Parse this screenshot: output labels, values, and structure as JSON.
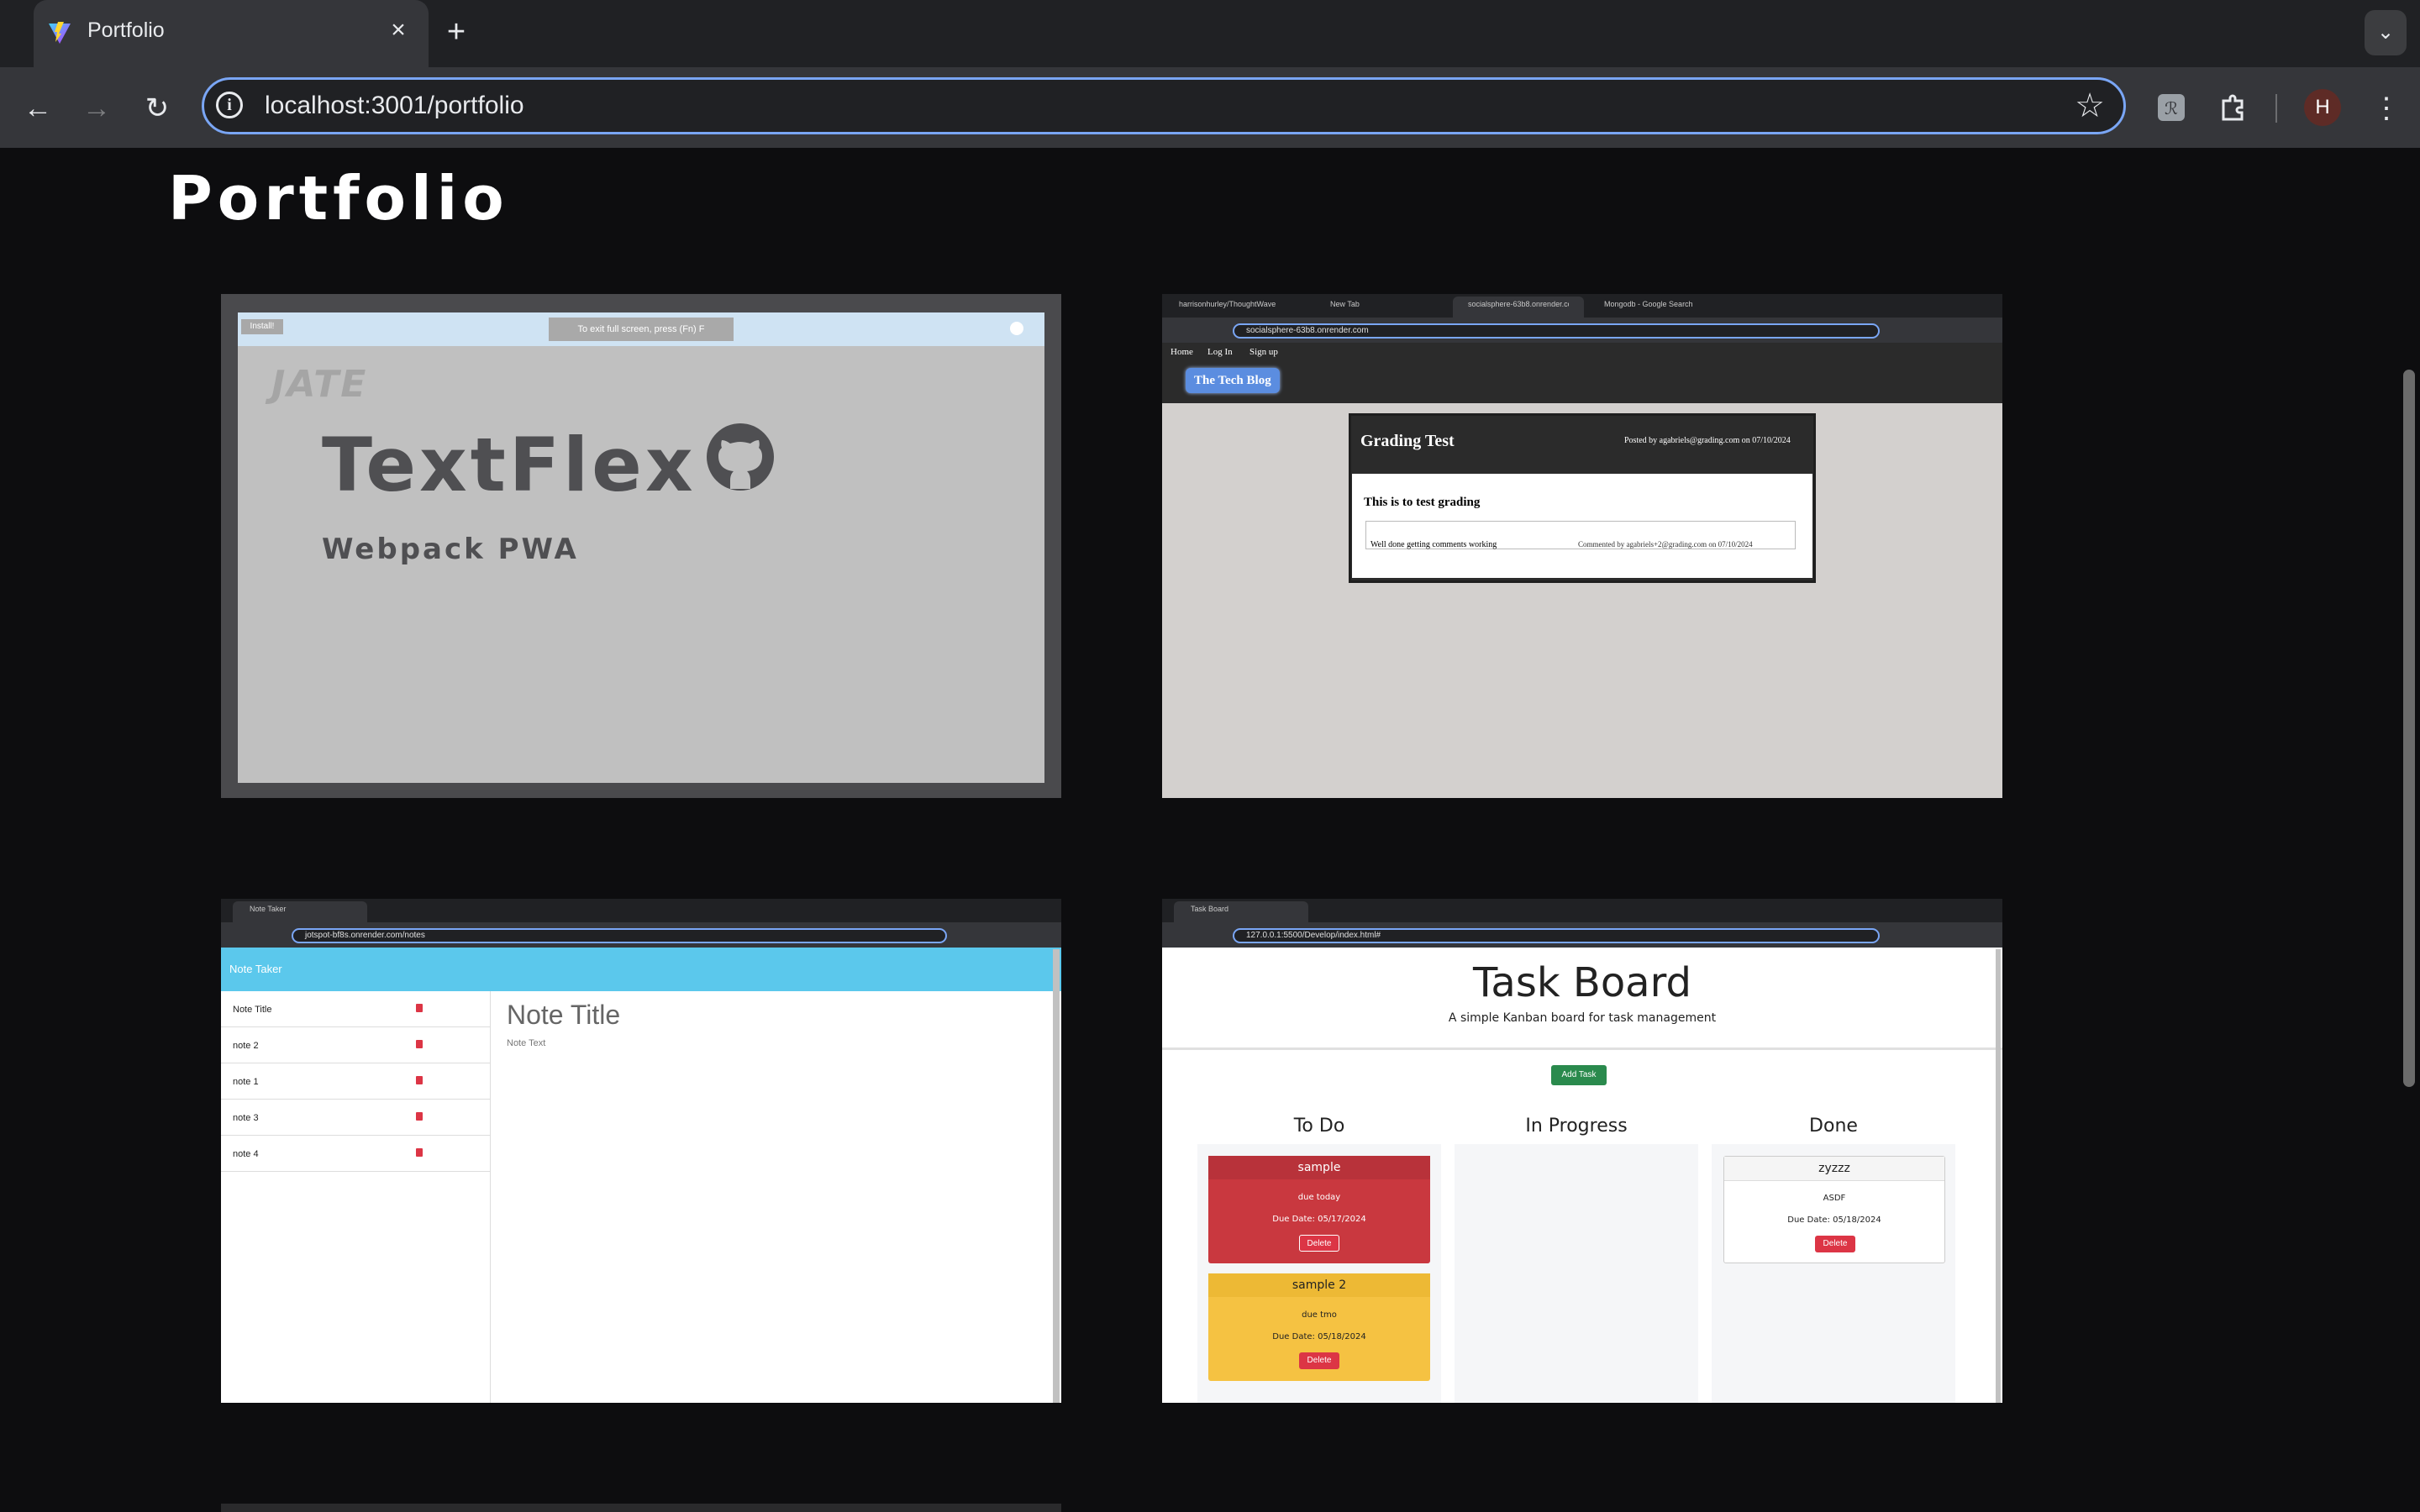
{
  "browser": {
    "tab_title": "Portfolio",
    "url": "localhost:3001/portfolio",
    "profile_initial": "H"
  },
  "page": {
    "heading": "Portfolio"
  },
  "projects": [
    {
      "title": "TextFlex",
      "subtitle": "Webpack PWA",
      "install_label": "Install!",
      "toast": "To exit full screen, press (Fn) F"
    },
    {
      "tabs": [
        "harrisonhurley/ThoughtWave",
        "New Tab",
        "socialsphere-63b8.onrender.com",
        "Mongodb - Google Search"
      ],
      "url": "socialsphere-63b8.onrender.com",
      "nav": [
        "Home",
        "Log In",
        "Sign up"
      ],
      "logo": "The Tech Blog",
      "post_title": "Grading Test",
      "post_meta": "Posted by agabriels@grading.com on 07/10/2024",
      "post_body": "This is to test grading",
      "comment_text": "Well done getting comments working",
      "comment_meta": "Commented by agabriels+2@grading.com on 07/10/2024"
    },
    {
      "tab": "Note Taker",
      "url": "jotspot-bf8s.onrender.com/notes",
      "header": "Note Taker",
      "notes": [
        "Note Title",
        "note 2",
        "note 1",
        "note 3",
        "note 4"
      ],
      "note_title": "Note Title",
      "note_text": "Note Text"
    },
    {
      "tab": "Task Board",
      "url": "127.0.0.1:5500/Develop/index.html#",
      "title": "Task Board",
      "subtitle": "A simple Kanban board for task management",
      "add_label": "Add Task",
      "columns": [
        "To Do",
        "In Progress",
        "Done"
      ],
      "tasks": [
        {
          "name": "sample",
          "desc": "due today",
          "due": "Due Date: 05/17/2024",
          "delete": "Delete"
        },
        {
          "name": "sample 2",
          "desc": "due tmo",
          "due": "Due Date: 05/18/2024",
          "delete": "Delete"
        },
        {
          "name": "zyzzz",
          "desc": "ASDF",
          "due": "Due Date: 05/18/2024",
          "delete": "Delete"
        }
      ]
    }
  ],
  "colors": {
    "accent": "#7aa6f5",
    "background": "#0d0d0f",
    "task_red": "#c9383f",
    "task_yellow": "#f5c242",
    "note_header": "#5bc8ec"
  },
  "icons": {
    "tab_favicon": "vite-logo-icon",
    "github": "github-icon",
    "trash": "trash-icon"
  }
}
